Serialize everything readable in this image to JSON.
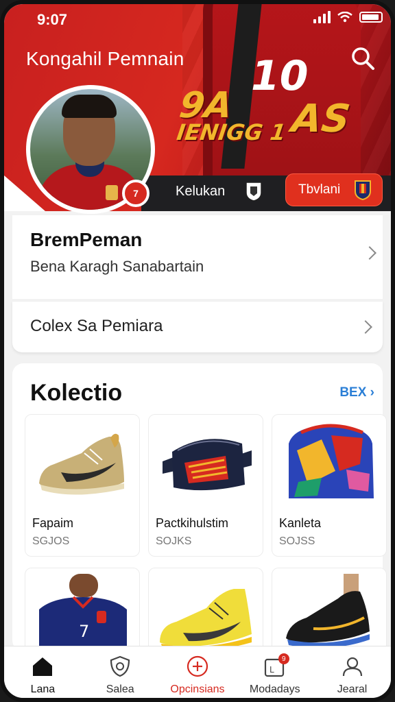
{
  "status_bar": {
    "time": "9:07"
  },
  "hero": {
    "title": "Kongahil Pemnain",
    "number": "10",
    "headline_left": "9A",
    "headline_sub": "IENIGG 1",
    "headline_right": "AS",
    "bar_label": "Kelukan",
    "follow_label": "Tbvlani",
    "avatar_tag": "7"
  },
  "profile_card": {
    "name": "BremPeman",
    "subtitle": "Bena Karagh Sanabartain"
  },
  "collection_link": {
    "label": "Colex Sa Pemiara"
  },
  "collection": {
    "title": "Kolectio",
    "see_all": "BEX",
    "items": [
      {
        "name": "Fapaim",
        "price": "SGJOS"
      },
      {
        "name": "Pactkihulstim",
        "price": "SOJKS"
      },
      {
        "name": "Kanleta",
        "price": "SOJSS"
      }
    ]
  },
  "bottom_nav": {
    "items": [
      {
        "label": "Lana"
      },
      {
        "label": "Salea"
      },
      {
        "label": "Opcinsians"
      },
      {
        "label": "Modadays"
      },
      {
        "label": "Jearal"
      }
    ],
    "badge": "9"
  },
  "colors": {
    "brand_red": "#d62a20",
    "accent_blue": "#2b7fd6",
    "headline_gold": "#f2b62c"
  }
}
